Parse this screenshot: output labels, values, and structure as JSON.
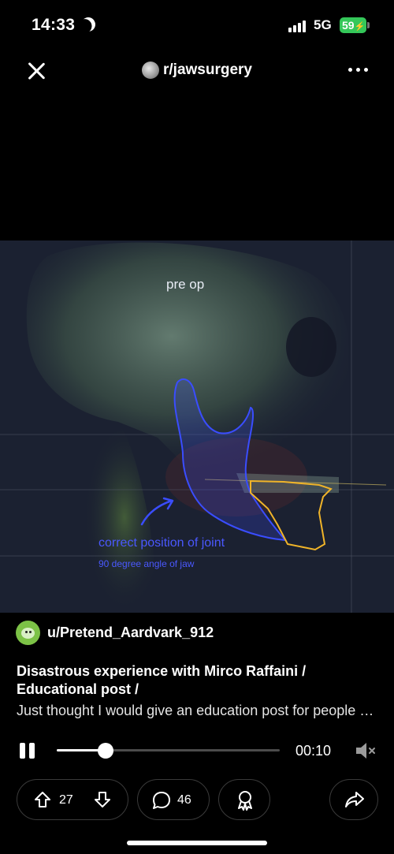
{
  "status_bar": {
    "time": "14:33",
    "network": "5G",
    "battery": "59"
  },
  "header": {
    "subreddit": "r/jawsurgery",
    "icons": [
      "close-icon",
      "more-icon"
    ]
  },
  "media": {
    "caption_top": "pre op",
    "caption_joint": "correct position of joint",
    "caption_angle": "90 degree angle of jaw",
    "annotation_colors": {
      "blue": "#3a4dff",
      "yellow": "#f0b429"
    }
  },
  "post": {
    "author": "u/Pretend_Aardvark_912",
    "title": "Disastrous experience with Mirco Raffaini / Educational post /",
    "body": "Just thought I would give an education post for people considering surgery with Mirco Raffaini"
  },
  "player": {
    "elapsed": "00:10",
    "progress": 0.22,
    "state": "playing"
  },
  "actions": {
    "votes": "27",
    "comments": "46"
  },
  "colors": {
    "background": "#000000",
    "battery": "#34c759",
    "pill_border": "#3a3a3a"
  }
}
